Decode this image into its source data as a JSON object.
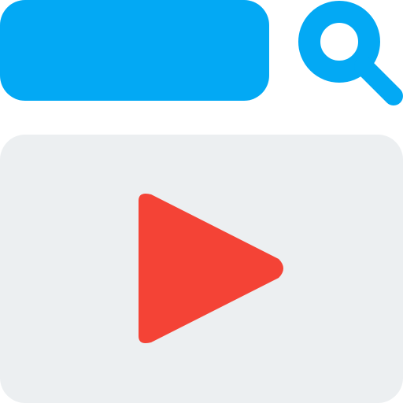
{
  "search": {
    "icon": "search-icon",
    "bar_color": "#03a9f4"
  },
  "video": {
    "icon": "play-icon",
    "panel_color": "#eceff1",
    "play_color": "#f44336"
  }
}
